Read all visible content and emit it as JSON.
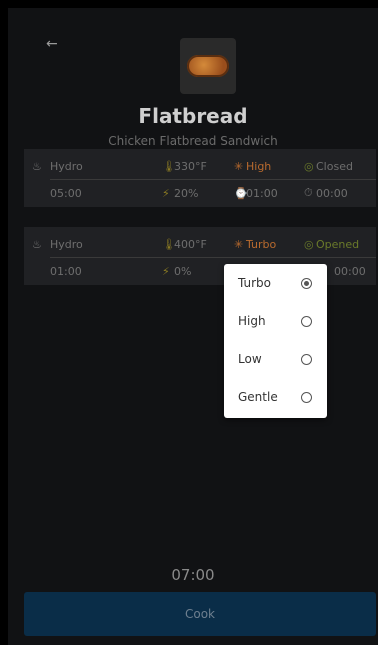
{
  "header": {
    "back_icon": "←",
    "title": "Flatbread",
    "subtitle": "Chicken Flatbread Sandwich"
  },
  "steps": [
    {
      "mode": "Hydro",
      "temperature": "330°F",
      "fan": "High",
      "vent": "Closed",
      "time": "05:00",
      "microwave": "20%",
      "duration": "01:00",
      "extra": "00:00"
    },
    {
      "mode": "Hydro",
      "temperature": "400°F",
      "fan": "Turbo",
      "vent": "Opened",
      "time": "01:00",
      "microwave": "0%",
      "extra": "00:00"
    }
  ],
  "fan_dropdown": {
    "options": [
      "Turbo",
      "High",
      "Low",
      "Gentle"
    ],
    "selected": "Turbo"
  },
  "footer": {
    "total_time": "07:00",
    "cook_label": "Cook"
  },
  "colors": {
    "background": "#111214",
    "card": "#202124",
    "button": "#0a2d48",
    "accent_orange": "#b86a2e"
  }
}
